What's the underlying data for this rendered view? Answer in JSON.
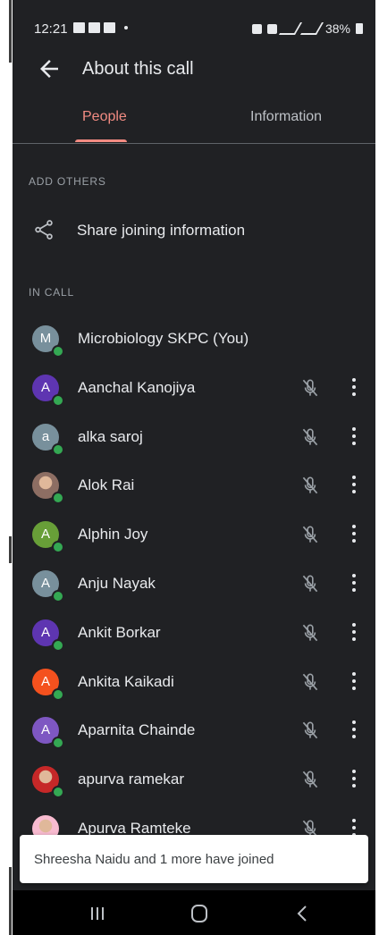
{
  "status_bar": {
    "time": "12:21",
    "battery": "38%"
  },
  "app_bar": {
    "title": "About this call"
  },
  "tabs": [
    {
      "label": "People",
      "selected": true
    },
    {
      "label": "Information",
      "selected": false
    }
  ],
  "sections": {
    "add_others": "ADD OTHERS",
    "in_call": "IN CALL"
  },
  "share": {
    "label": "Share joining information",
    "icon": "share-icon"
  },
  "participants": [
    {
      "name": "Microbiology SKPC (You)",
      "initial": "M",
      "avatar_color": "#78909c",
      "photo": false,
      "self": true
    },
    {
      "name": "Aanchal Kanojiya",
      "initial": "A",
      "avatar_color": "#5e35b1",
      "photo": false,
      "self": false
    },
    {
      "name": "alka saroj",
      "initial": "a",
      "avatar_color": "#78909c",
      "photo": false,
      "self": false
    },
    {
      "name": "Alok Rai",
      "initial": "",
      "avatar_color": "#8d6e63",
      "photo": true,
      "self": false
    },
    {
      "name": "Alphin Joy",
      "initial": "A",
      "avatar_color": "#689f38",
      "photo": false,
      "self": false
    },
    {
      "name": "Anju Nayak",
      "initial": "A",
      "avatar_color": "#78909c",
      "photo": false,
      "self": false
    },
    {
      "name": "Ankit Borkar",
      "initial": "A",
      "avatar_color": "#5e35b1",
      "photo": false,
      "self": false
    },
    {
      "name": "Ankita Kaikadi",
      "initial": "A",
      "avatar_color": "#f4511e",
      "photo": false,
      "self": false
    },
    {
      "name": "Aparnita Chainde",
      "initial": "A",
      "avatar_color": "#7e57c2",
      "photo": false,
      "self": false
    },
    {
      "name": "apurva ramekar",
      "initial": "",
      "avatar_color": "#c62828",
      "photo": true,
      "self": false
    },
    {
      "name": "Apurva Ramteke",
      "initial": "",
      "avatar_color": "#f8bbd0",
      "photo": true,
      "self": false
    }
  ],
  "toast": {
    "text": "Shreesha Naidu and 1 more have joined"
  },
  "colors": {
    "background": "#202124",
    "accent": "#f28b82",
    "online": "#34a853"
  }
}
